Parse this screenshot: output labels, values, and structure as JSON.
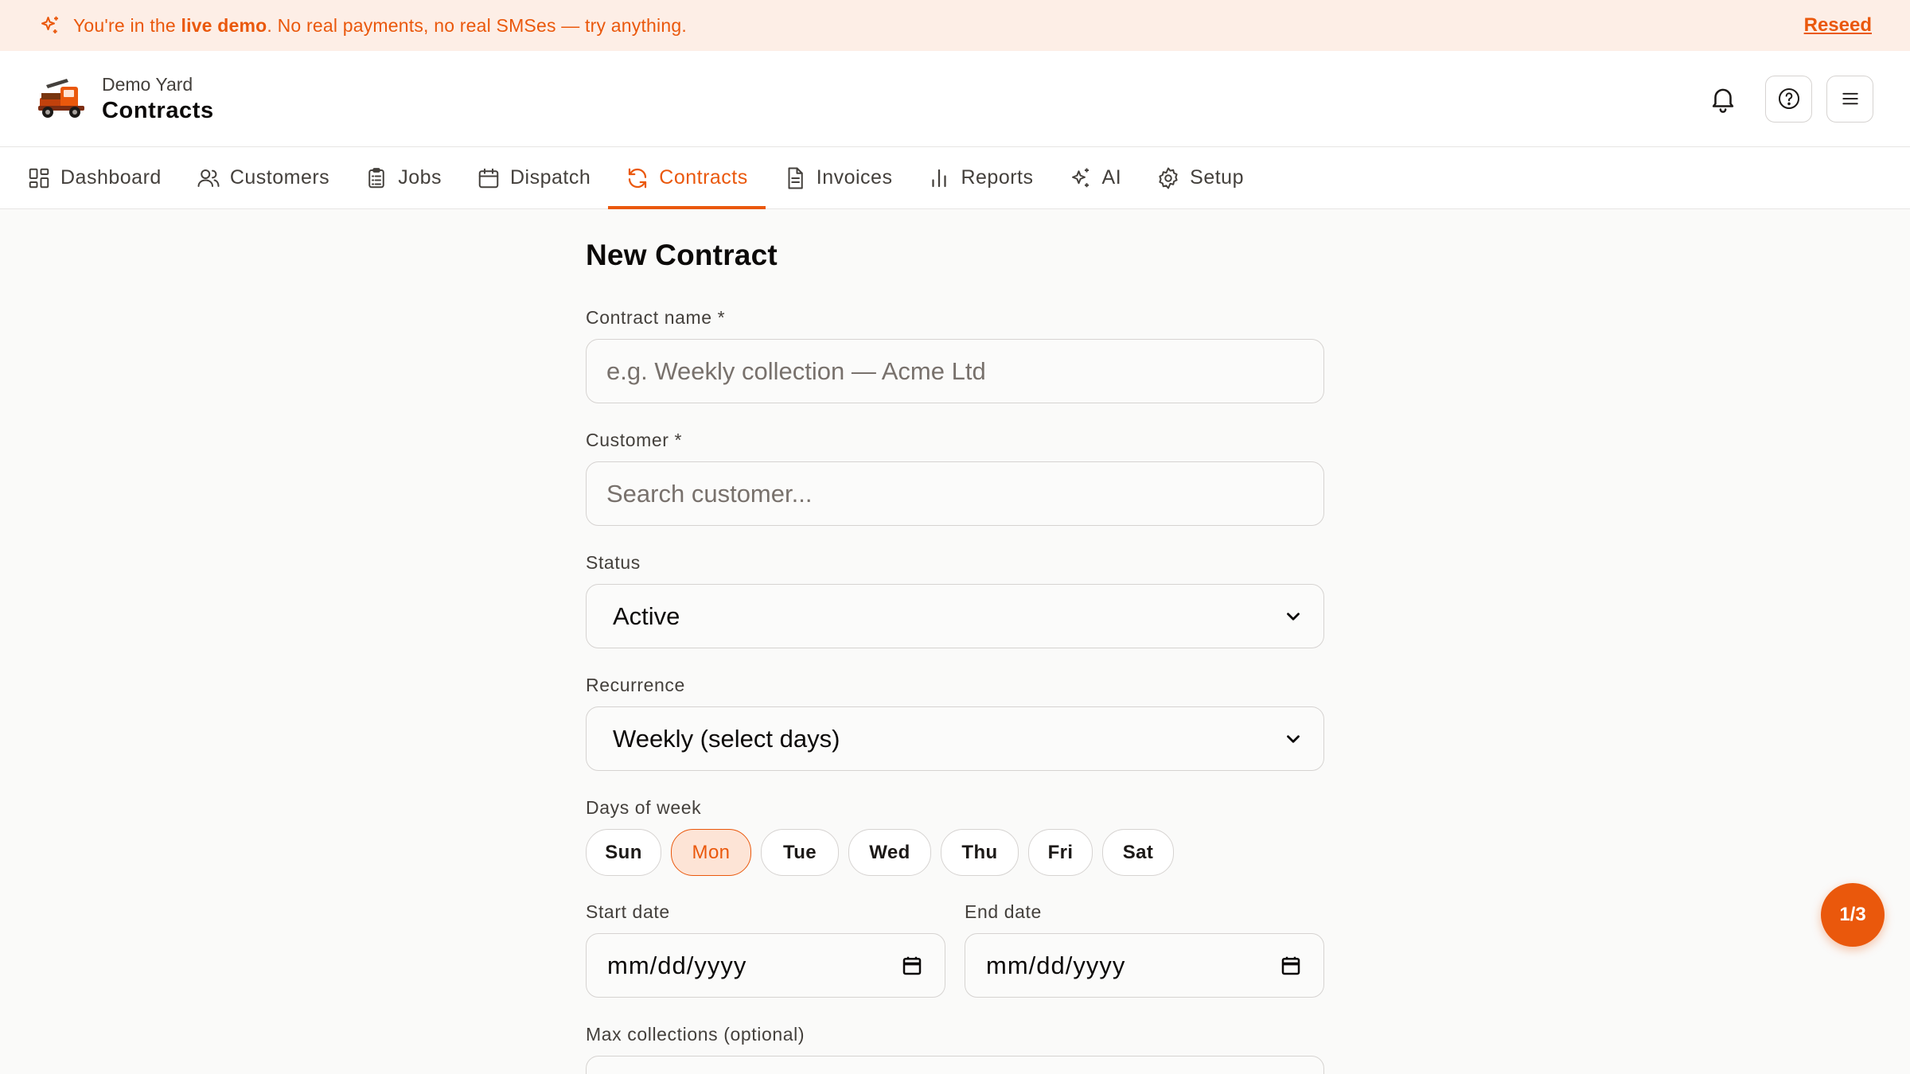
{
  "banner": {
    "prefix": "You're in the ",
    "bold": "live demo",
    "suffix": ". No real payments, no real SMSes — try anything.",
    "reseed_label": "Reseed"
  },
  "header": {
    "yard": "Demo Yard",
    "page_title": "Contracts"
  },
  "nav": {
    "items": [
      {
        "label": "Dashboard",
        "icon": "dashboard-icon"
      },
      {
        "label": "Customers",
        "icon": "users-icon"
      },
      {
        "label": "Jobs",
        "icon": "clipboard-icon"
      },
      {
        "label": "Dispatch",
        "icon": "calendar-icon"
      },
      {
        "label": "Contracts",
        "icon": "refresh-icon",
        "active": true
      },
      {
        "label": "Invoices",
        "icon": "document-icon"
      },
      {
        "label": "Reports",
        "icon": "bar-chart-icon"
      },
      {
        "label": "AI",
        "icon": "sparkles-icon"
      },
      {
        "label": "Setup",
        "icon": "gear-icon"
      }
    ]
  },
  "form": {
    "title": "New Contract",
    "contract_name": {
      "label": "Contract name *",
      "placeholder": "e.g. Weekly collection — Acme Ltd"
    },
    "customer": {
      "label": "Customer *",
      "placeholder": "Search customer..."
    },
    "status": {
      "label": "Status",
      "value": "Active"
    },
    "recurrence": {
      "label": "Recurrence",
      "value": "Weekly (select days)"
    },
    "days": {
      "label": "Days of week",
      "items": [
        {
          "label": "Sun",
          "selected": false
        },
        {
          "label": "Mon",
          "selected": true
        },
        {
          "label": "Tue",
          "selected": false
        },
        {
          "label": "Wed",
          "selected": false
        },
        {
          "label": "Thu",
          "selected": false
        },
        {
          "label": "Fri",
          "selected": false
        },
        {
          "label": "Sat",
          "selected": false
        }
      ]
    },
    "start_date": {
      "label": "Start date",
      "value": "mm/dd/yyyy"
    },
    "end_date": {
      "label": "End date",
      "value": "mm/dd/yyyy"
    },
    "max_collections": {
      "label": "Max collections (optional)"
    }
  },
  "fab": {
    "label": "1/3"
  },
  "colors": {
    "accent": "#ea580c",
    "banner_bg": "#fdeee6",
    "page_bg": "#fafaf9"
  }
}
